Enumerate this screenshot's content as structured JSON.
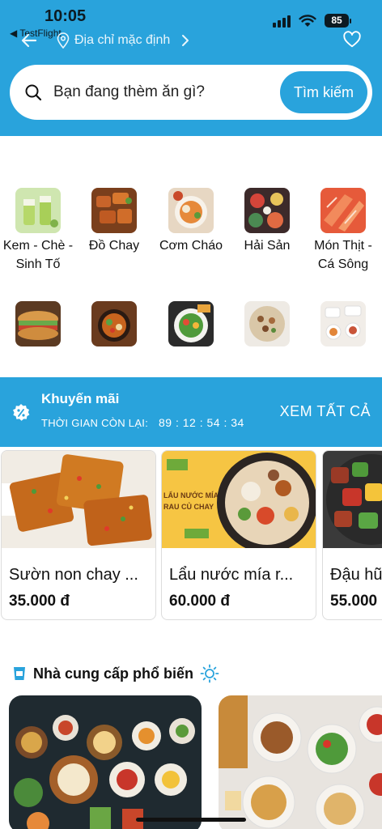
{
  "status": {
    "time": "10:05",
    "back_app": "◀ TestFlight",
    "battery": "85"
  },
  "header": {
    "address": "Địa chỉ mặc định"
  },
  "search": {
    "placeholder": "Bạn đang thèm ăn gì?",
    "button": "Tìm kiếm"
  },
  "categories": [
    {
      "label": "Kem - Chè - Sinh Tố",
      "icon": "smoothie-photo"
    },
    {
      "label": "Đồ Chay",
      "icon": "vegan-food-photo"
    },
    {
      "label": "Cơm Cháo",
      "icon": "rice-porridge-photo"
    },
    {
      "label": "Hải Sản",
      "icon": "seafood-photo"
    },
    {
      "label": "Món Thịt - Cá Sông",
      "icon": "meat-fish-photo"
    },
    {
      "label": "",
      "icon": "banh-mi-photo"
    },
    {
      "label": "",
      "icon": "hotpot-photo"
    },
    {
      "label": "",
      "icon": "salad-photo"
    },
    {
      "label": "",
      "icon": "noodle-photo"
    },
    {
      "label": "",
      "icon": "snack-photo"
    }
  ],
  "promo": {
    "title": "Khuyến mãi",
    "timer_label": "THỜI GIAN CÒN LẠI:",
    "timer": "89 : 12 : 54 : 34",
    "see_all": "XEM TẤT CẢ"
  },
  "products": [
    {
      "name": "Sườn non chay ...",
      "price": "35.000  đ",
      "banner_text": ""
    },
    {
      "name": "Lẩu nước mía r...",
      "price": "60.000  đ",
      "banner_text": "LẨU NƯỚC MÍA RAU CỦ CHAY"
    },
    {
      "name": "Đậu hũ",
      "price": "55.000",
      "banner_text": ""
    }
  ],
  "suppliers": {
    "title": "Nhà cung cấp phổ biến"
  },
  "colors": {
    "primary": "#29a3dc",
    "text": "#111111",
    "card_border": "#dcdcdc"
  }
}
